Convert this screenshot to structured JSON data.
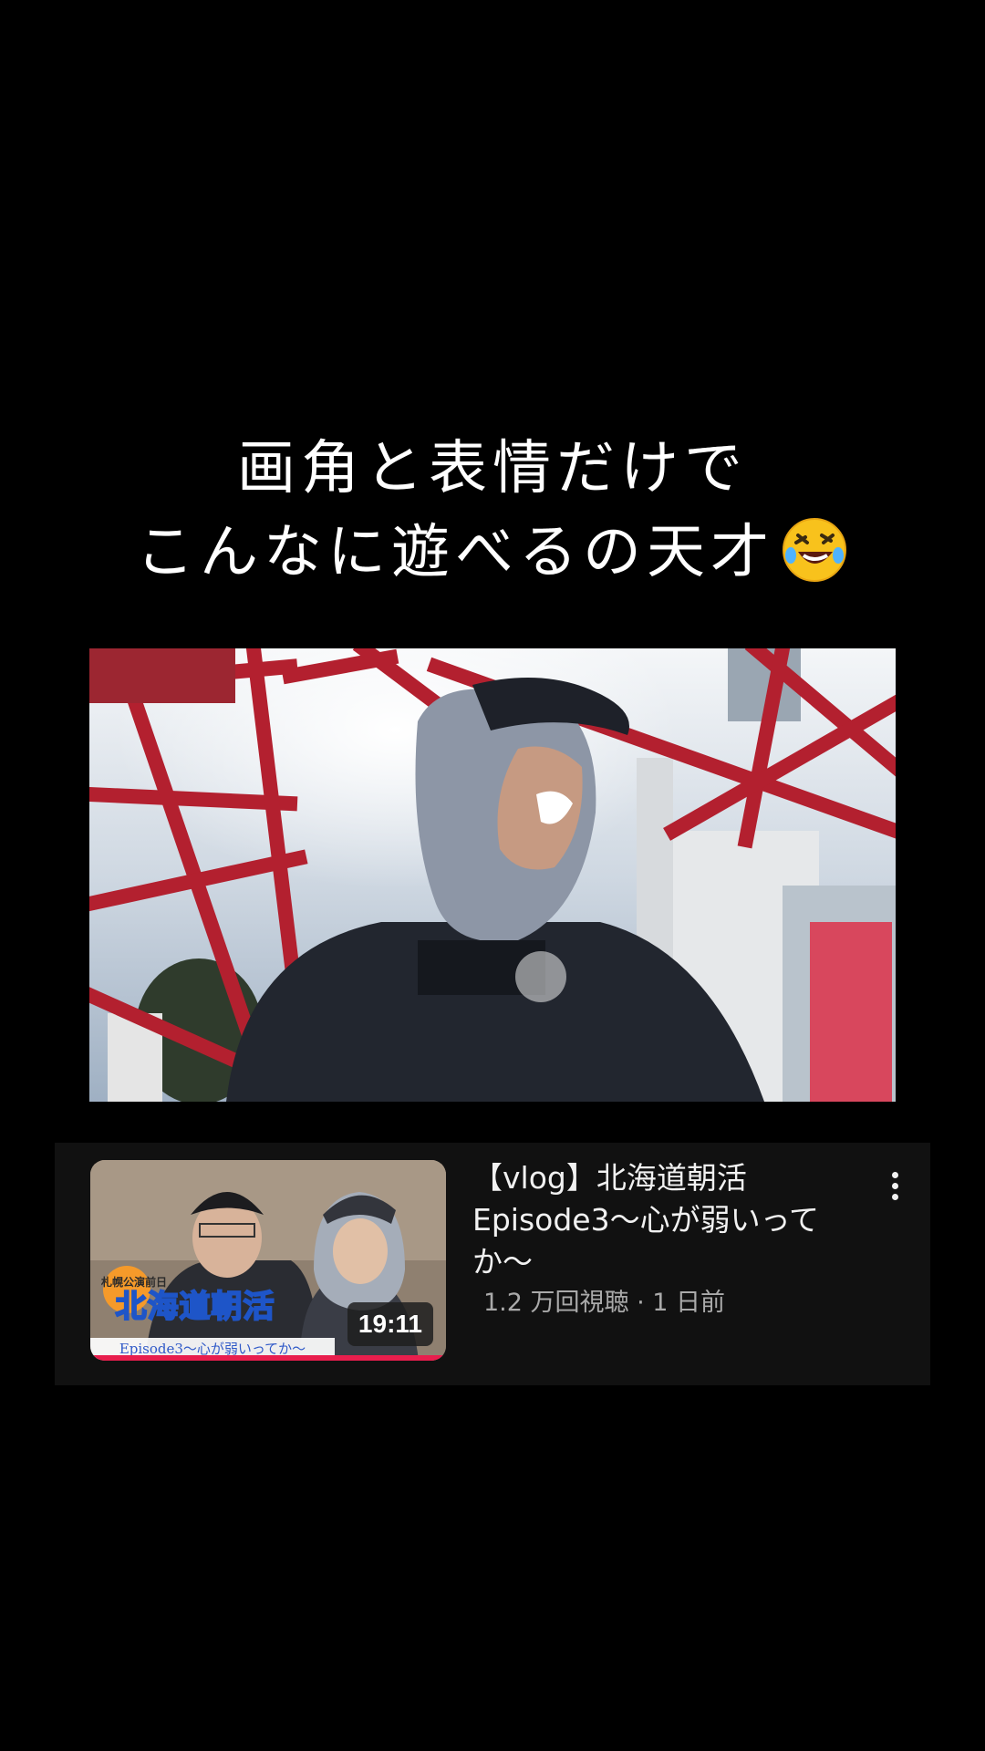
{
  "caption": {
    "line1": "画角と表情だけで",
    "line2": "こんなに遊べるの天才",
    "emoji": "rolling-on-floor-laughing-emoji"
  },
  "video_card": {
    "thumbnail": {
      "badge_top": "札幌公演前日",
      "logo_text": "北海道朝活",
      "subtitle": "Episode3～心が弱いってか～",
      "duration": "19:11"
    },
    "title": "【vlog】北海道朝活 Episode3～心が弱いってか～",
    "meta": "1.2 万回視聴 · 1 日前",
    "more_icon": "more-vertical-icon",
    "progress_color": "#e81e4d"
  }
}
